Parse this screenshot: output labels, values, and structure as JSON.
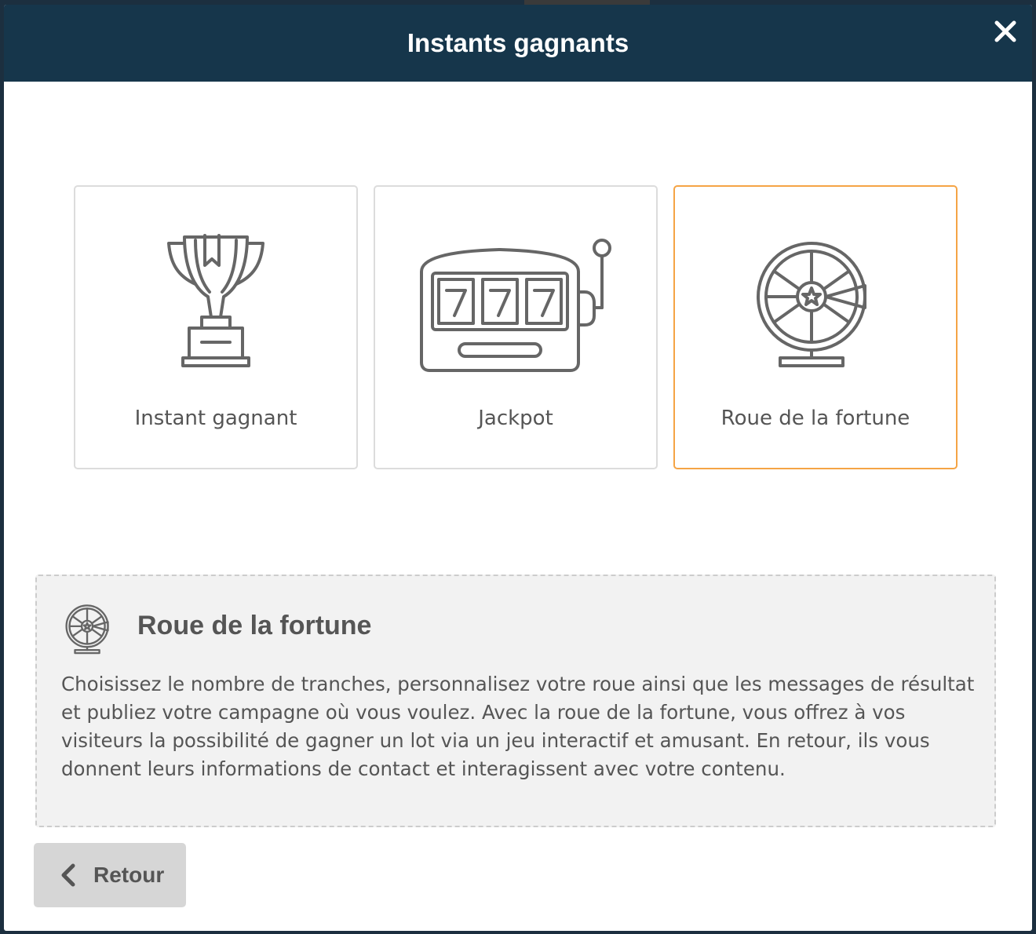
{
  "modal": {
    "title": "Instants gagnants",
    "close_icon": "close-icon"
  },
  "cards": [
    {
      "label": "Instant gagnant",
      "icon": "trophy-icon",
      "selected": false
    },
    {
      "label": "Jackpot",
      "icon": "slot-machine-icon",
      "selected": false
    },
    {
      "label": "Roue de la fortune",
      "icon": "fortune-wheel-icon",
      "selected": true
    }
  ],
  "description": {
    "icon": "fortune-wheel-icon",
    "title": "Roue de la fortune",
    "text": "Choisissez le nombre de tranches, personnalisez votre roue ainsi que les messages de résultat et publiez votre campagne où vous voulez. Avec la roue de la fortune, vous offrez à vos visiteurs la possibilité de gagner un lot via un jeu interactif et amusant. En retour, ils vous donnent leurs informations de contact et interagissent avec votre contenu."
  },
  "back_button": {
    "label": "Retour",
    "icon": "chevron-left-icon"
  },
  "colors": {
    "header": "#16364b",
    "selected_border": "#f5a445",
    "icon_stroke": "#666666"
  }
}
